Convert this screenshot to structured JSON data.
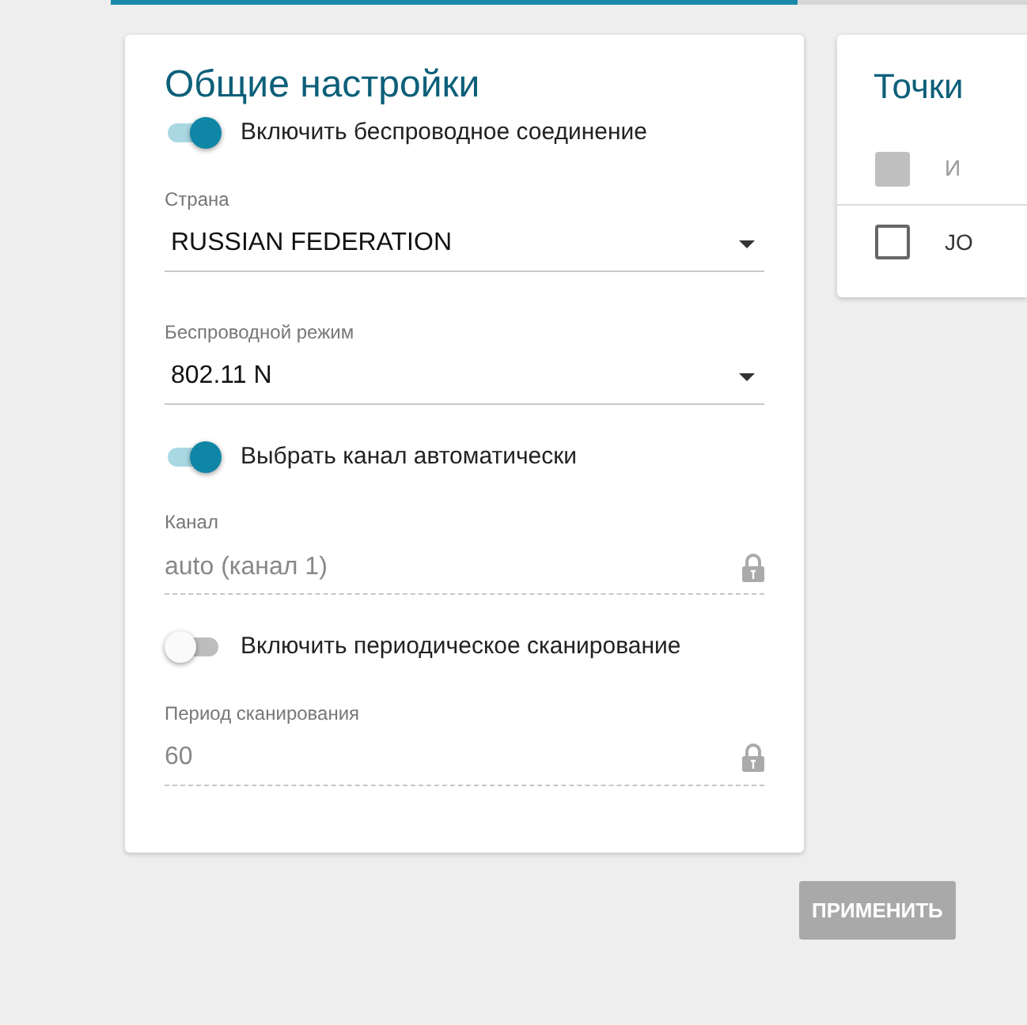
{
  "top_tabs_bar": {
    "level": 0.75
  },
  "general_settings": {
    "title": "Общие настройки",
    "items": [
      {
        "kind": "toggle",
        "label": "Включить беспроводное соединение",
        "on": true
      },
      {
        "kind": "select",
        "label": "Страна",
        "value": "RUSSIAN FEDERATION"
      },
      {
        "kind": "select",
        "label": "Беспроводной режим",
        "value": "802.11 N"
      },
      {
        "kind": "toggle",
        "label": "Выбрать канал автоматически",
        "on": true
      },
      {
        "kind": "locked",
        "label": "Канал",
        "value": "auto (канал 1)"
      },
      {
        "kind": "toggle",
        "label": "Включить периодическое сканирование",
        "on": false
      },
      {
        "kind": "locked",
        "label": "Период сканирования",
        "value": "60"
      }
    ]
  },
  "access_points": {
    "title": "Точки",
    "header_checkbox": {
      "disabled": true
    },
    "column_1": "И",
    "rows": [
      {
        "cell": "JO",
        "checked": false
      }
    ]
  },
  "apply_button": {
    "label": "ПРИМЕНИТЬ",
    "disabled": true
  }
}
